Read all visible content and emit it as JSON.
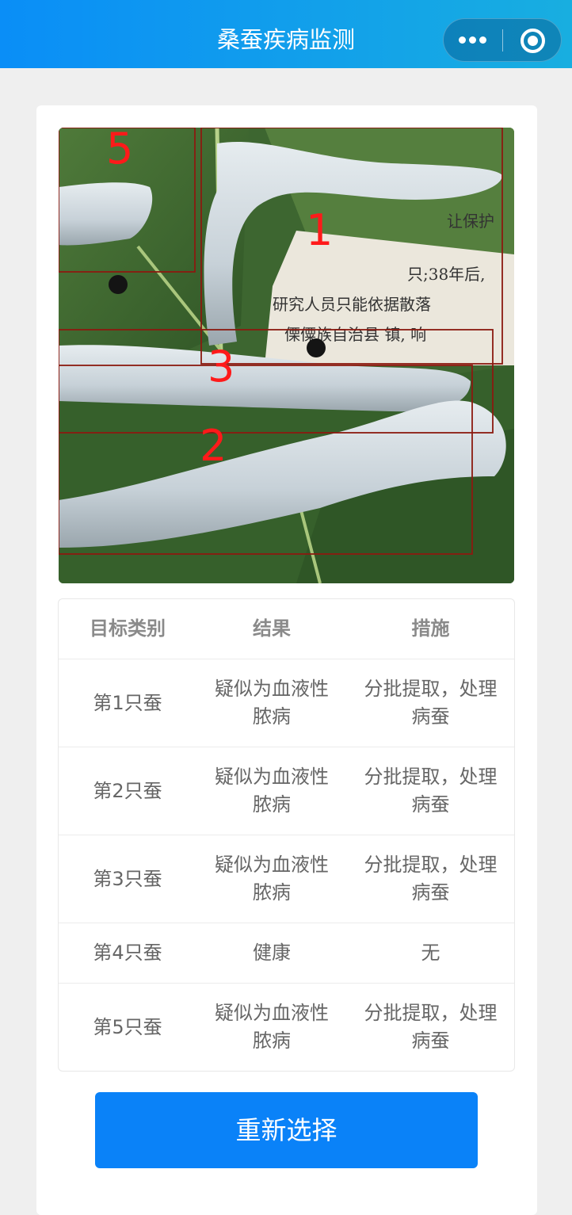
{
  "navbar": {
    "title": "桑蚕疾病监测",
    "more_icon": "more-dots-icon",
    "close_icon": "target-circle-icon"
  },
  "image": {
    "description_icon": "silkworm-photo",
    "box_labels": [
      "1",
      "2",
      "3",
      "5"
    ],
    "box_color": "#8b1a10",
    "label_color": "#ff1a1a"
  },
  "table": {
    "headers": [
      "目标类别",
      "结果",
      "措施"
    ],
    "rows": [
      {
        "target": "第1只蚕",
        "result_line1": "疑似为血液性",
        "result_line2": "脓病",
        "measure_line1": "分批提取，处理",
        "measure_line2": "病蚕"
      },
      {
        "target": "第2只蚕",
        "result_line1": "疑似为血液性",
        "result_line2": "脓病",
        "measure_line1": "分批提取，处理",
        "measure_line2": "病蚕"
      },
      {
        "target": "第3只蚕",
        "result_line1": "疑似为血液性",
        "result_line2": "脓病",
        "measure_line1": "分批提取，处理",
        "measure_line2": "病蚕"
      },
      {
        "target": "第4只蚕",
        "result_line1": "健康",
        "result_line2": "",
        "measure_line1": "无",
        "measure_line2": ""
      },
      {
        "target": "第5只蚕",
        "result_line1": "疑似为血液性",
        "result_line2": "脓病",
        "measure_line1": "分批提取，处理",
        "measure_line2": "病蚕"
      }
    ]
  },
  "actions": {
    "reselect_label": "重新选择"
  },
  "colors": {
    "nav_start": "#0a8ef7",
    "nav_end": "#18aee0",
    "button": "#0a82f8"
  }
}
